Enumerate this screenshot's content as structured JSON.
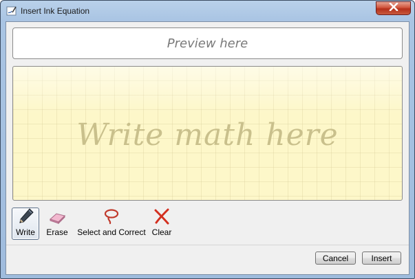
{
  "window": {
    "title": "Insert Ink Equation"
  },
  "preview": {
    "placeholder": "Preview here"
  },
  "writing_area": {
    "placeholder": "Write math here"
  },
  "toolbar": {
    "tools": [
      {
        "label": "Write",
        "icon": "pen-icon",
        "selected": true
      },
      {
        "label": "Erase",
        "icon": "eraser-icon",
        "selected": false
      },
      {
        "label": "Select and Correct",
        "icon": "lasso-icon",
        "selected": false
      },
      {
        "label": "Clear",
        "icon": "clear-x-icon",
        "selected": false
      }
    ]
  },
  "buttons": {
    "cancel": "Cancel",
    "insert": "Insert"
  },
  "colors": {
    "title_bar": "#a9c4e3",
    "close_button": "#c74a34",
    "writing_area_background": "#fdf7c9",
    "hint_text": "#c9c08c"
  }
}
